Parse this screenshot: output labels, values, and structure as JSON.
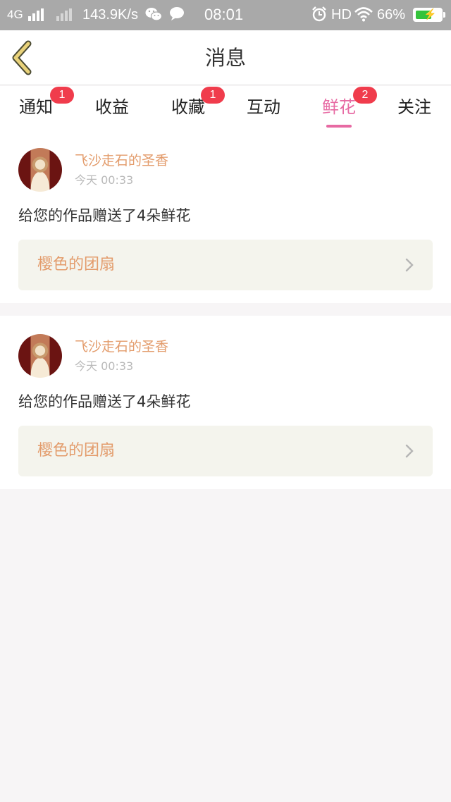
{
  "status_bar": {
    "network": "4G",
    "speed": "143.9K/s",
    "time": "08:01",
    "hd": "HD",
    "battery": "66%",
    "battery_level": 0.66,
    "battery_color": "#34c33b"
  },
  "header": {
    "title": "消息",
    "back_icon": "chevron-left-icon"
  },
  "tabs": [
    {
      "label": "通知",
      "badge": "1",
      "active": false
    },
    {
      "label": "收益",
      "badge": "",
      "active": false
    },
    {
      "label": "收藏",
      "badge": "1",
      "active": false
    },
    {
      "label": "互动",
      "badge": "",
      "active": false
    },
    {
      "label": "鲜花",
      "badge": "2",
      "active": true
    },
    {
      "label": "关注",
      "badge": "",
      "active": false
    }
  ],
  "messages": [
    {
      "user": "飞沙走石的圣香",
      "time": "今天 00:33",
      "text": "给您的作品赠送了4朵鲜花",
      "work": "樱色的团扇"
    },
    {
      "user": "飞沙走石的圣香",
      "time": "今天 00:33",
      "text": "给您的作品赠送了4朵鲜花",
      "work": "樱色的团扇"
    }
  ],
  "colors": {
    "accent_pink": "#e76aa3",
    "name_orange": "#e39c6c",
    "badge_red": "#f03c4c",
    "back_yellow": "#e9d27a"
  }
}
